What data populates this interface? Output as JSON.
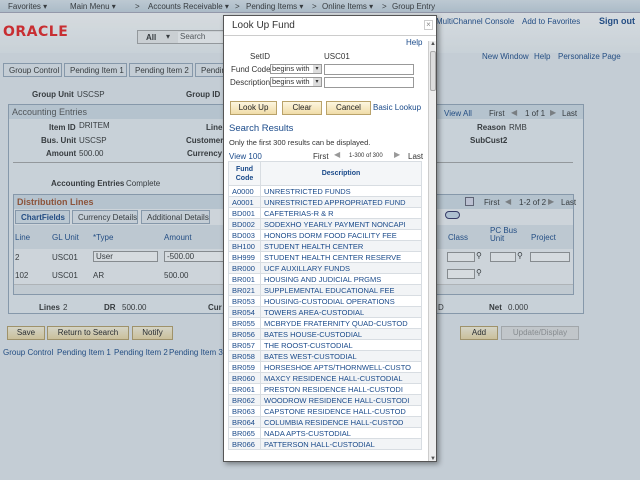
{
  "nav": {
    "items": [
      "Favorites ▾",
      "Main Menu ▾",
      ">",
      "Accounts Receivable ▾",
      ">",
      "Pending Items ▾",
      ">",
      "Online Items ▾",
      ">",
      "Group Entry"
    ]
  },
  "header": {
    "logo": "ORACLE",
    "search_scope": "All",
    "search_placeholder": "Search",
    "links": [
      "MultiChannel Console",
      "Add to Favorites",
      "Sign out"
    ]
  },
  "pagebar": {
    "links": [
      "New Window",
      "Help",
      "Personalize Page"
    ]
  },
  "tabs": [
    "Group Control",
    "Pending Item 1",
    "Pending Item 2",
    "Pending Item 3"
  ],
  "group": {
    "unit_label": "Group Unit",
    "unit": "USCSP",
    "id_label": "Group ID"
  },
  "acct": {
    "title": "Accounting Entries",
    "nav": {
      "view_all": "View All",
      "first": "First",
      "count": "1 of 1",
      "last": "Last"
    },
    "item_id_label": "Item ID",
    "item_id": "DRITEM",
    "line_label": "Line",
    "bus_unit_label": "Bus. Unit",
    "bus_unit": "USCSP",
    "customer_label": "Customer",
    "amount_label": "Amount",
    "amount": "500.00",
    "currency_label": "Currency",
    "reason_label": "Reason",
    "reason": "RMB",
    "subcust2": "SubCust2",
    "entries_label": "Accounting Entries",
    "entries_status": "Complete"
  },
  "dist": {
    "title": "Distribution Lines",
    "nav": {
      "first": "First",
      "count": "1-2 of 2",
      "last": "Last"
    },
    "tabs": [
      "ChartFields",
      "Currency Details",
      "Additional Details"
    ],
    "columns": [
      "Line",
      "GL Unit",
      "*Type",
      "Amount",
      "Class",
      "PC Bus Unit",
      "Project"
    ],
    "rows": [
      {
        "line": "2",
        "gl": "USC01",
        "type": "User",
        "amount": "-500.00"
      },
      {
        "line": "102",
        "gl": "USC01",
        "type": "AR",
        "amount": "500.00"
      }
    ],
    "totals": {
      "lines_label": "Lines",
      "lines": "2",
      "dr_label": "DR",
      "dr": "500.00",
      "cur_label": "Cur",
      "net_label": "Net",
      "net": "0.000",
      "d_suffix": "D"
    }
  },
  "buttons": {
    "save": "Save",
    "return": "Return to Search",
    "notify": "Notify",
    "add": "Add",
    "update": "Update/Display"
  },
  "footer_links": [
    "Group Control",
    "Pending Item 1",
    "Pending Item 2",
    "Pending Item 3"
  ],
  "modal": {
    "title": "Look Up Fund",
    "close": "×",
    "help": "Help",
    "setid_label": "SetID",
    "setid": "USC01",
    "fund_label": "Fund Code",
    "desc_label": "Description",
    "operator": "begins with",
    "fund_value": "",
    "desc_value": "",
    "lookup": "Look Up",
    "clear": "Clear",
    "cancel": "Cancel",
    "basic": "Basic Lookup",
    "results_title": "Search Results",
    "notice": "Only the first 300 results can be displayed.",
    "view100": "View 100",
    "first": "First",
    "count": "1-300 of 300",
    "last": "Last",
    "col_code": "Fund Code",
    "col_desc": "Description",
    "rows": [
      [
        "A0000",
        "UNRESTRICTED FUNDS"
      ],
      [
        "A0001",
        "UNRESTRICTED APPROPRIATED FUND"
      ],
      [
        "BD001",
        "CAFETERIAS-R & R"
      ],
      [
        "BD002",
        "SODEXHO YEARLY PAYMENT NONCAPI"
      ],
      [
        "BD003",
        "HONORS DORM FOOD FACILITY FEE"
      ],
      [
        "BH100",
        "STUDENT HEALTH CENTER"
      ],
      [
        "BH999",
        "STUDENT HEALTH CENTER RESERVE"
      ],
      [
        "BR000",
        "UCF AUXILLARY FUNDS"
      ],
      [
        "BR001",
        "HOUSING AND JUDICIAL PRGMS"
      ],
      [
        "BR021",
        "SUPPLEMENTAL EDUCATIONAL FEE"
      ],
      [
        "BR053",
        "HOUSING-CUSTODIAL OPERATIONS"
      ],
      [
        "BR054",
        "TOWERS AREA-CUSTODIAL"
      ],
      [
        "BR055",
        "MCBRYDE FRATERNITY QUAD-CUSTOD"
      ],
      [
        "BR056",
        "BATES HOUSE-CUSTODIAL"
      ],
      [
        "BR057",
        "THE ROOST-CUSTODIAL"
      ],
      [
        "BR058",
        "BATES WEST-CUSTODIAL"
      ],
      [
        "BR059",
        "HORSESHOE APTS/THORNWELL-CUSTO"
      ],
      [
        "BR060",
        "MAXCY RESIDENCE HALL-CUSTODIAL"
      ],
      [
        "BR061",
        "PRESTON RESIDENCE HALL-CUSTODI"
      ],
      [
        "BR062",
        "WOODROW RESIDENCE HALL-CUSTODI"
      ],
      [
        "BR063",
        "CAPSTONE RESIDENCE HALL-CUSTOD"
      ],
      [
        "BR064",
        "COLUMBIA RESIDENCE HALL-CUSTOD"
      ],
      [
        "BR065",
        "NADA APTS-CUSTODIAL"
      ],
      [
        "BR066",
        "PATTERSON HALL-CUSTODIAL"
      ]
    ]
  }
}
